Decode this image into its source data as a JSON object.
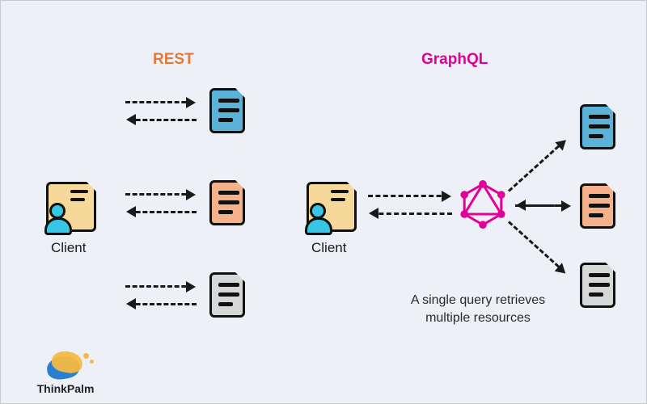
{
  "headings": {
    "rest": "REST",
    "graphql": "GraphQL"
  },
  "labels": {
    "client_left": "Client",
    "client_right": "Client"
  },
  "caption": "A single query retrieves\nmultiple resources",
  "logo_text": "ThinkPalm",
  "resources": {
    "types": [
      "blue",
      "orange",
      "grey"
    ]
  },
  "colors": {
    "rest_heading": "#e07a3a",
    "graphql_heading": "#e10098",
    "background": "#eef0f7",
    "client_card": "#f6d89a",
    "client_person": "#38c6e6",
    "doc_blue": "#5bb2d9",
    "doc_orange": "#f4b18a",
    "doc_grey": "#d6d7d9"
  }
}
